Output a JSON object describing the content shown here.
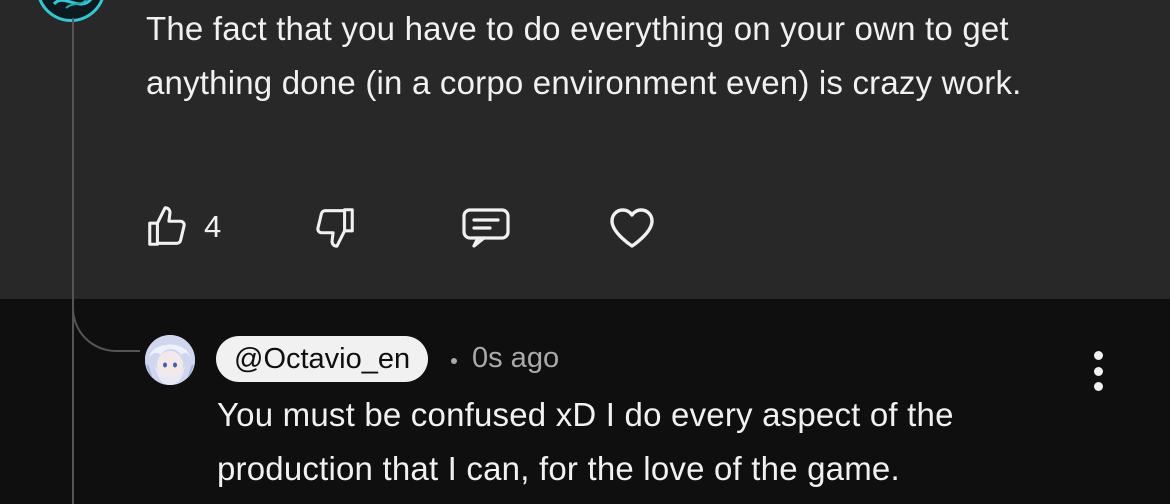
{
  "parent_comment": {
    "text": "The fact that you have to do everything on your own to get anything done (in a corpo environment even) is crazy work.",
    "like_count": "4",
    "icons": {
      "like": "thumbs-up-icon",
      "dislike": "thumbs-down-icon",
      "reply": "comment-icon",
      "heart": "heart-icon",
      "menu": "more-vertical-icon"
    }
  },
  "reply": {
    "username": "@Octavio_en",
    "separator": "·",
    "timestamp": "0s ago",
    "text": "You must be confused xD I do every aspect of the production that I can, for the love of the game.",
    "icons": {
      "menu": "more-vertical-icon"
    }
  },
  "colors": {
    "parent_background": "#282828",
    "reply_background": "#0f0f0f",
    "text_primary": "#f1f1f1",
    "text_secondary": "#aaaaaa",
    "avatar_ring": "#35c6d0"
  }
}
